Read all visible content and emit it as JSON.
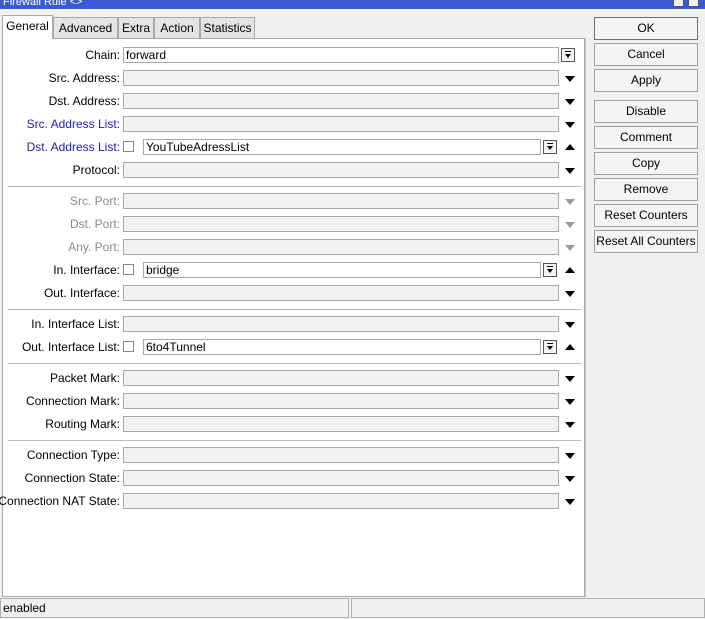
{
  "window": {
    "title": "Firewall Rule <>"
  },
  "tabs": [
    {
      "label": "General",
      "active": true
    },
    {
      "label": "Advanced"
    },
    {
      "label": "Extra"
    },
    {
      "label": "Action"
    },
    {
      "label": "Statistics"
    }
  ],
  "fields": {
    "chain": {
      "label": "Chain:",
      "value": "forward"
    },
    "src_address": {
      "label": "Src. Address:"
    },
    "dst_address": {
      "label": "Dst. Address:"
    },
    "src_address_list": {
      "label": "Src. Address List:"
    },
    "dst_address_list": {
      "label": "Dst. Address List:",
      "value": "YouTubeAdressList"
    },
    "protocol": {
      "label": "Protocol:"
    },
    "src_port": {
      "label": "Src. Port:"
    },
    "dst_port": {
      "label": "Dst. Port:"
    },
    "any_port": {
      "label": "Any. Port:"
    },
    "in_interface": {
      "label": "In. Interface:",
      "value": "bridge"
    },
    "out_interface": {
      "label": "Out. Interface:"
    },
    "in_interface_list": {
      "label": "In. Interface List:"
    },
    "out_interface_list": {
      "label": "Out. Interface List:",
      "value": "6to4Tunnel"
    },
    "packet_mark": {
      "label": "Packet Mark:"
    },
    "connection_mark": {
      "label": "Connection Mark:"
    },
    "routing_mark": {
      "label": "Routing Mark:"
    },
    "connection_type": {
      "label": "Connection Type:"
    },
    "connection_state": {
      "label": "Connection State:"
    },
    "connection_nat_state": {
      "label": "Connection NAT State:"
    }
  },
  "buttons": {
    "ok": "OK",
    "cancel": "Cancel",
    "apply": "Apply",
    "disable": "Disable",
    "comment": "Comment",
    "copy": "Copy",
    "remove": "Remove",
    "reset_counters": "Reset Counters",
    "reset_all_counters": "Reset All Counters"
  },
  "status": {
    "state": "enabled"
  },
  "colors": {
    "title_bar": "#3c59d4",
    "label_blue": "#2020c0",
    "label_disabled": "#8a8a8a"
  }
}
